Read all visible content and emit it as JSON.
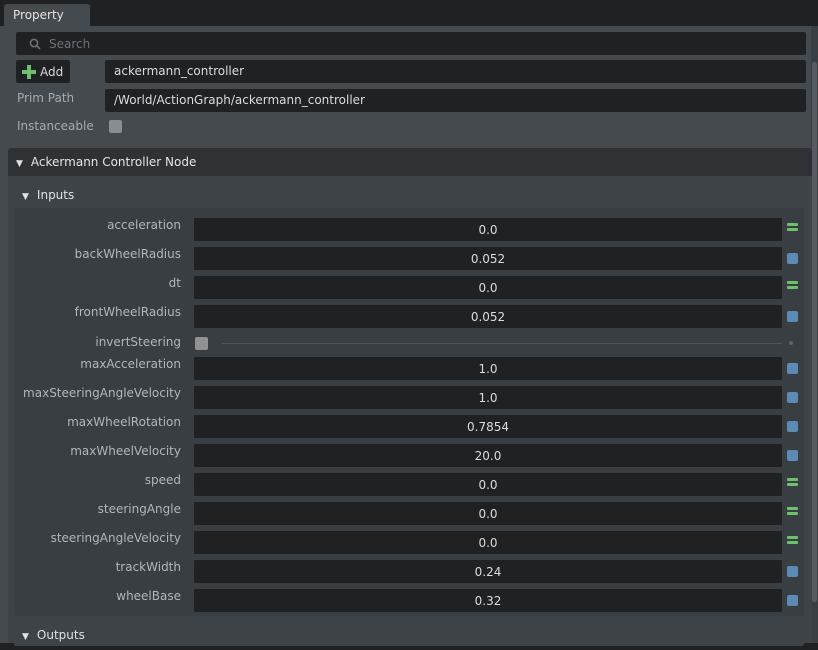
{
  "tab": {
    "title": "Property"
  },
  "search": {
    "placeholder": "Search"
  },
  "toolbar": {
    "add_label": "Add",
    "name_value": "ackermann_controller"
  },
  "prim_path": {
    "label": "Prim Path",
    "value": "/World/ActionGraph/ackermann_controller"
  },
  "instanceable": {
    "label": "Instanceable",
    "checked": false
  },
  "section": {
    "title": "Ackermann Controller Node"
  },
  "inputs": {
    "title": "Inputs",
    "rows": [
      {
        "label": "acceleration",
        "value": "0.0",
        "indicator": "green"
      },
      {
        "label": "backWheelRadius",
        "value": "0.052",
        "indicator": "blue"
      },
      {
        "label": "dt",
        "value": "0.0",
        "indicator": "green"
      },
      {
        "label": "frontWheelRadius",
        "value": "0.052",
        "indicator": "blue"
      },
      {
        "label": "invertSteering",
        "value": "",
        "indicator": "dot"
      },
      {
        "label": "maxAcceleration",
        "value": "1.0",
        "indicator": "blue"
      },
      {
        "label": "maxSteeringAngleVelocity",
        "value": "1.0",
        "indicator": "blue"
      },
      {
        "label": "maxWheelRotation",
        "value": "0.7854",
        "indicator": "blue"
      },
      {
        "label": "maxWheelVelocity",
        "value": "20.0",
        "indicator": "blue"
      },
      {
        "label": "speed",
        "value": "0.0",
        "indicator": "green"
      },
      {
        "label": "steeringAngle",
        "value": "0.0",
        "indicator": "green"
      },
      {
        "label": "steeringAngleVelocity",
        "value": "0.0",
        "indicator": "green"
      },
      {
        "label": "trackWidth",
        "value": "0.24",
        "indicator": "blue"
      },
      {
        "label": "wheelBase",
        "value": "0.32",
        "indicator": "blue"
      }
    ]
  },
  "outputs": {
    "title": "Outputs"
  },
  "colors": {
    "accent_blue": "#5b8ab5",
    "accent_green": "#6fbf6f"
  }
}
